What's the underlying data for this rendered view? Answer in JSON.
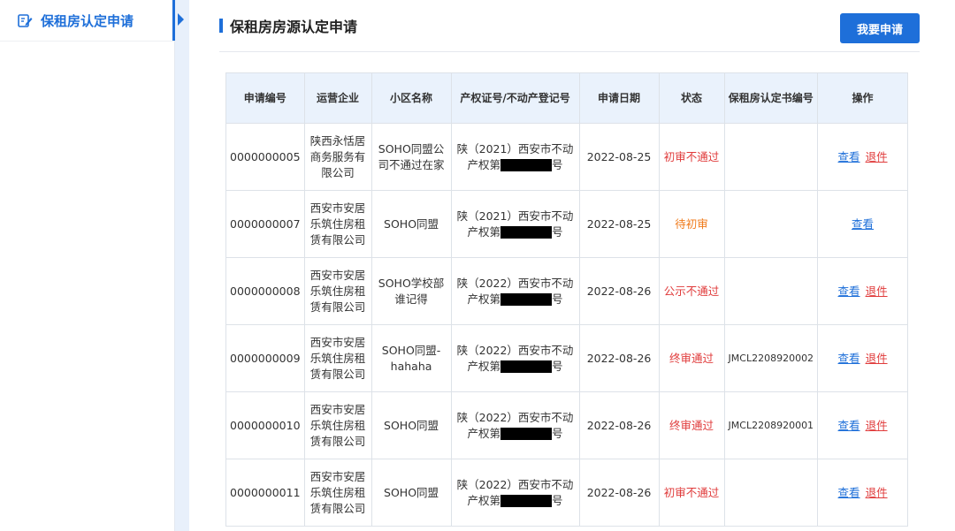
{
  "sidebar": {
    "items": [
      {
        "label": "保租房认定申请",
        "icon": "edit-icon"
      }
    ]
  },
  "page": {
    "title": "保租房房源认定申请",
    "apply_button": "我要申请"
  },
  "table": {
    "headers": [
      "申请编号",
      "运营企业",
      "小区名称",
      "产权证号/不动产登记号",
      "申请日期",
      "状态",
      "保租房认定书编号",
      "操作"
    ],
    "rows": [
      {
        "id": "0000000005",
        "company": "陕西永恬居商务服务有限公司",
        "community": "SOHO同盟公司不通过在家",
        "cert_prefix": "陕（2021）西安市不动产权第",
        "cert_suffix": "号",
        "date": "2022-08-25",
        "status": "初审不通过",
        "status_color": "#e03b3b",
        "cert_no": "",
        "view": "查看",
        "withdraw": "退件"
      },
      {
        "id": "0000000007",
        "company": "西安市安居乐筑住房租赁有限公司",
        "community": "SOHO同盟",
        "cert_prefix": "陕（2021）西安市不动产权第",
        "cert_suffix": "号",
        "date": "2022-08-25",
        "status": "待初审",
        "status_color": "#f07a1a",
        "cert_no": "",
        "view": "查看",
        "withdraw": ""
      },
      {
        "id": "0000000008",
        "company": "西安市安居乐筑住房租赁有限公司",
        "community": "SOHO学校部谁记得",
        "cert_prefix": "陕（2022）西安市不动产权第",
        "cert_suffix": "号",
        "date": "2022-08-26",
        "status": "公示不通过",
        "status_color": "#e03b3b",
        "cert_no": "",
        "view": "查看",
        "withdraw": "退件"
      },
      {
        "id": "0000000009",
        "company": "西安市安居乐筑住房租赁有限公司",
        "community": "SOHO同盟-hahaha",
        "cert_prefix": "陕（2022）西安市不动产权第",
        "cert_suffix": "号",
        "date": "2022-08-26",
        "status": "终审通过",
        "status_color": "#e03b3b",
        "cert_no": "JMCL2208920002",
        "view": "查看",
        "withdraw": "退件"
      },
      {
        "id": "0000000010",
        "company": "西安市安居乐筑住房租赁有限公司",
        "community": "SOHO同盟",
        "cert_prefix": "陕（2022）西安市不动产权第",
        "cert_suffix": "号",
        "date": "2022-08-26",
        "status": "终审通过",
        "status_color": "#e03b3b",
        "cert_no": "JMCL2208920001",
        "view": "查看",
        "withdraw": "退件"
      },
      {
        "id": "0000000011",
        "company": "西安市安居乐筑住房租赁有限公司",
        "community": "SOHO同盟",
        "cert_prefix": "陕（2022）西安市不动产权第",
        "cert_suffix": "号",
        "date": "2022-08-26",
        "status": "初审不通过",
        "status_color": "#e03b3b",
        "cert_no": "",
        "view": "查看",
        "withdraw": "退件"
      }
    ]
  },
  "colors": {
    "accent": "#1e6fd9",
    "header_bg": "#eaf2fc",
    "danger": "#e03b3b",
    "warning": "#f07a1a"
  }
}
